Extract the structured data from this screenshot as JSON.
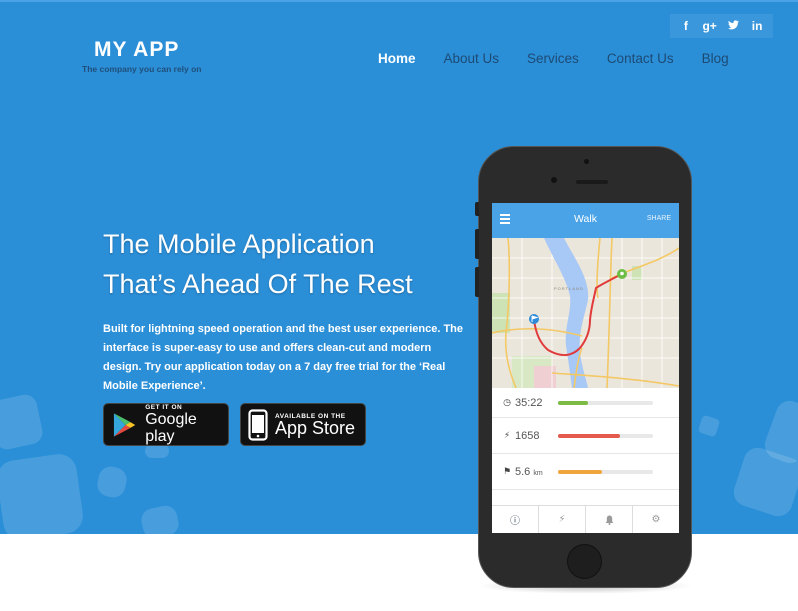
{
  "brand": {
    "title": "MY APP",
    "tagline": "The company you can rely on"
  },
  "social": [
    {
      "icon": "facebook-icon",
      "glyph": "f"
    },
    {
      "icon": "google-plus-icon",
      "glyph": "g+"
    },
    {
      "icon": "twitter-icon",
      "glyph": "t"
    },
    {
      "icon": "linkedin-icon",
      "glyph": "in"
    }
  ],
  "nav": {
    "items": [
      {
        "label": "Home",
        "active": true
      },
      {
        "label": "About Us",
        "active": false
      },
      {
        "label": "Services",
        "active": false
      },
      {
        "label": "Contact Us",
        "active": false
      },
      {
        "label": "Blog",
        "active": false
      }
    ]
  },
  "hero": {
    "headline_line1": "The Mobile Application",
    "headline_line2": "That’s Ahead Of The Rest",
    "description": "Built for lightning speed operation and the best user experience. The interface is super-easy to use and offers clean-cut and modern design. Try our application today on a 7 day free trial for the ‘Real Mobile Experience’."
  },
  "store_buttons": {
    "google": {
      "small": "GET IT ON",
      "big": "Google play"
    },
    "apple": {
      "small": "AVAILABLE ON THE",
      "big": "App Store"
    }
  },
  "phone_app": {
    "title": "Walk",
    "share_label": "SHARE",
    "map_label": "PORTLAND",
    "stats": [
      {
        "icon": "clock-icon",
        "glyph": "◷",
        "value": "35:22",
        "unit": "",
        "progress": 0.32,
        "color": "#7dbb45"
      },
      {
        "icon": "steps-icon",
        "glyph": "⚡",
        "value": "1658",
        "unit": "",
        "progress": 0.65,
        "color": "#e45a4c"
      },
      {
        "icon": "flag-icon",
        "glyph": "⚑",
        "value": "5.6",
        "unit": "km",
        "progress": 0.46,
        "color": "#f0a53c"
      }
    ],
    "tabs": [
      {
        "icon": "info-icon",
        "glyph": "ⓘ",
        "active": true
      },
      {
        "icon": "activity-icon",
        "glyph": "⚡",
        "active": false
      },
      {
        "icon": "bell-icon",
        "glyph": "🔔",
        "active": false
      },
      {
        "icon": "settings-icon",
        "glyph": "⚙",
        "active": false
      }
    ]
  },
  "colors": {
    "hero_bg": "#2b8fd8",
    "nav_text": "#1d4a73",
    "app_bar": "#4aa3e6"
  }
}
